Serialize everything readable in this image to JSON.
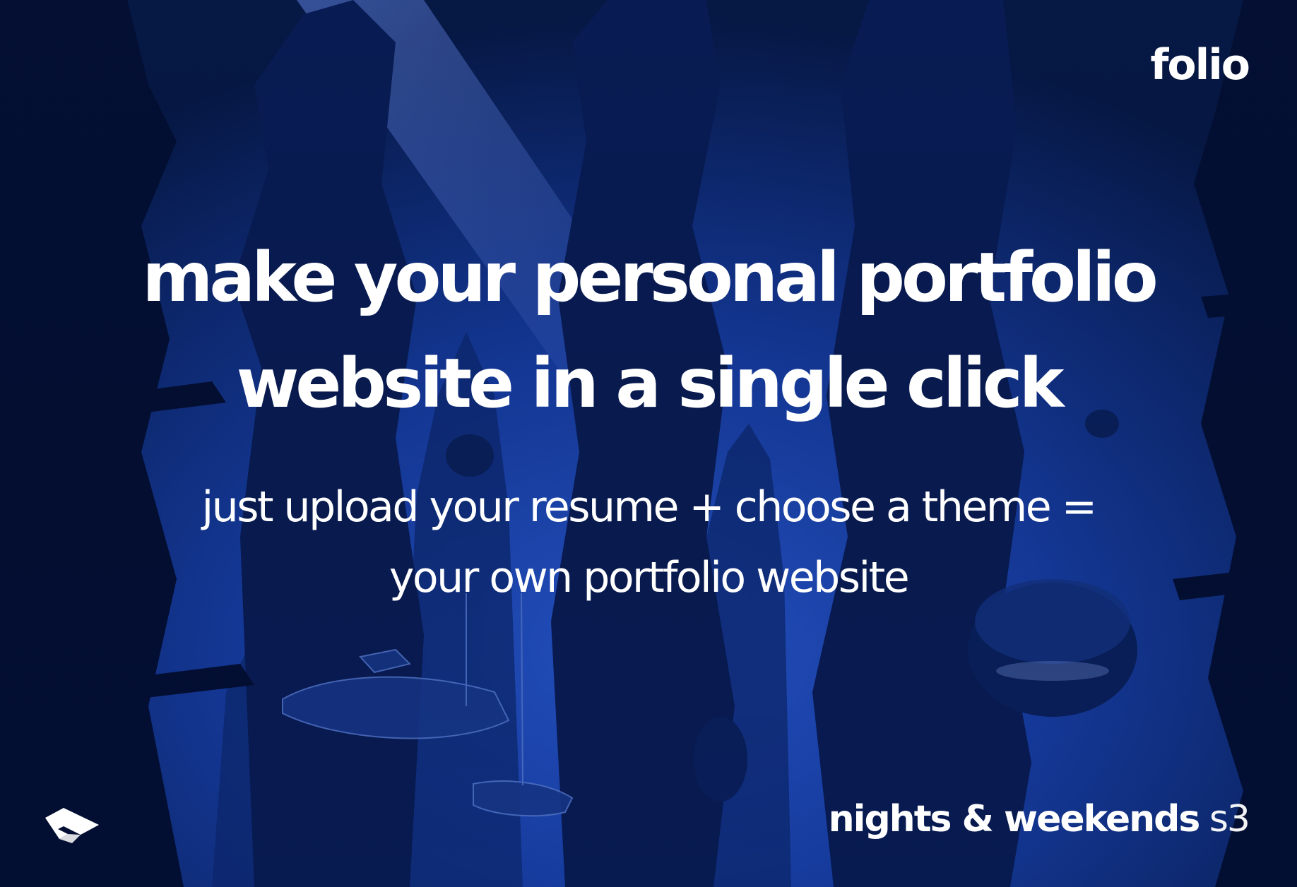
{
  "brand": "folio",
  "headline": {
    "line1": "make your personal portfolio",
    "line2": "website in a single click"
  },
  "subhead": {
    "line1": "just upload your resume + choose a theme =",
    "line2": "your own portfolio website"
  },
  "footer": {
    "event_name": "nights & weekends",
    "season": "s3",
    "logo_icon": "buildspace-logo-icon"
  },
  "colors": {
    "background_deep": "#06122e",
    "background_mid": "#123a9c",
    "background_bright": "#2f63e6",
    "text": "#ffffff"
  }
}
